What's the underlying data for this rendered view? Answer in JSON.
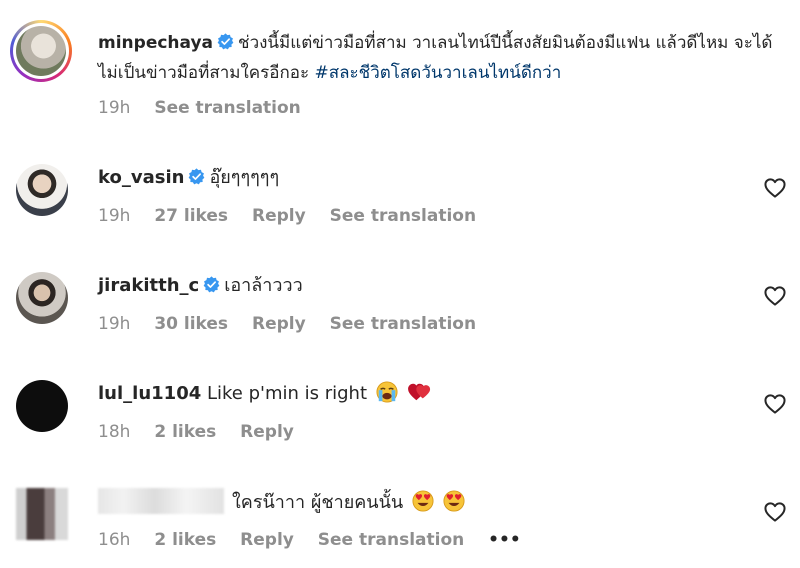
{
  "caption": {
    "username": "minpechaya",
    "text": "ช่วงนี้มีแต่ข่าวมือที่สาม วาเลนไทน์ปีนี้สงสัยมินต้องมีแฟน แล้วดีไหม จะได้ไม่เป็นข่าวมือที่สามใครอีกอะ",
    "hashtag": "#สละชีวิตโสดวันวาเลนไทน์ดีกว่า",
    "time": "19h",
    "see_translation": "See translation"
  },
  "comments": [
    {
      "username": "ko_vasin",
      "verified": true,
      "text": "อุ๊ยๆๆๆๆๆ",
      "time": "19h",
      "likes": "27 likes",
      "reply": "Reply",
      "see_translation": "See translation"
    },
    {
      "username": "jirakitth_c",
      "verified": true,
      "text": "เอาล้าววว",
      "time": "19h",
      "likes": "30 likes",
      "reply": "Reply",
      "see_translation": "See translation"
    },
    {
      "username": "lul_lu1104",
      "verified": false,
      "text": "Like p'min is right",
      "time": "18h",
      "likes": "2 likes",
      "reply": "Reply"
    },
    {
      "username": "",
      "verified": false,
      "text": "ใครน๊าาา ผู้ชายคนนั้น",
      "time": "16h",
      "likes": "2 likes",
      "reply": "Reply",
      "see_translation": "See translation",
      "more": "•••"
    }
  ],
  "icons": {
    "verified": "verified-badge-icon",
    "heart": "heart-outline-icon",
    "crying": "loudly-crying-face-emoji",
    "heart_emoji": "red-heart-emoji",
    "heart_eyes": "heart-eyes-emoji"
  },
  "colors": {
    "verified": "#3897f0",
    "hashtag": "#00376b",
    "meta": "#8e8e8e"
  }
}
